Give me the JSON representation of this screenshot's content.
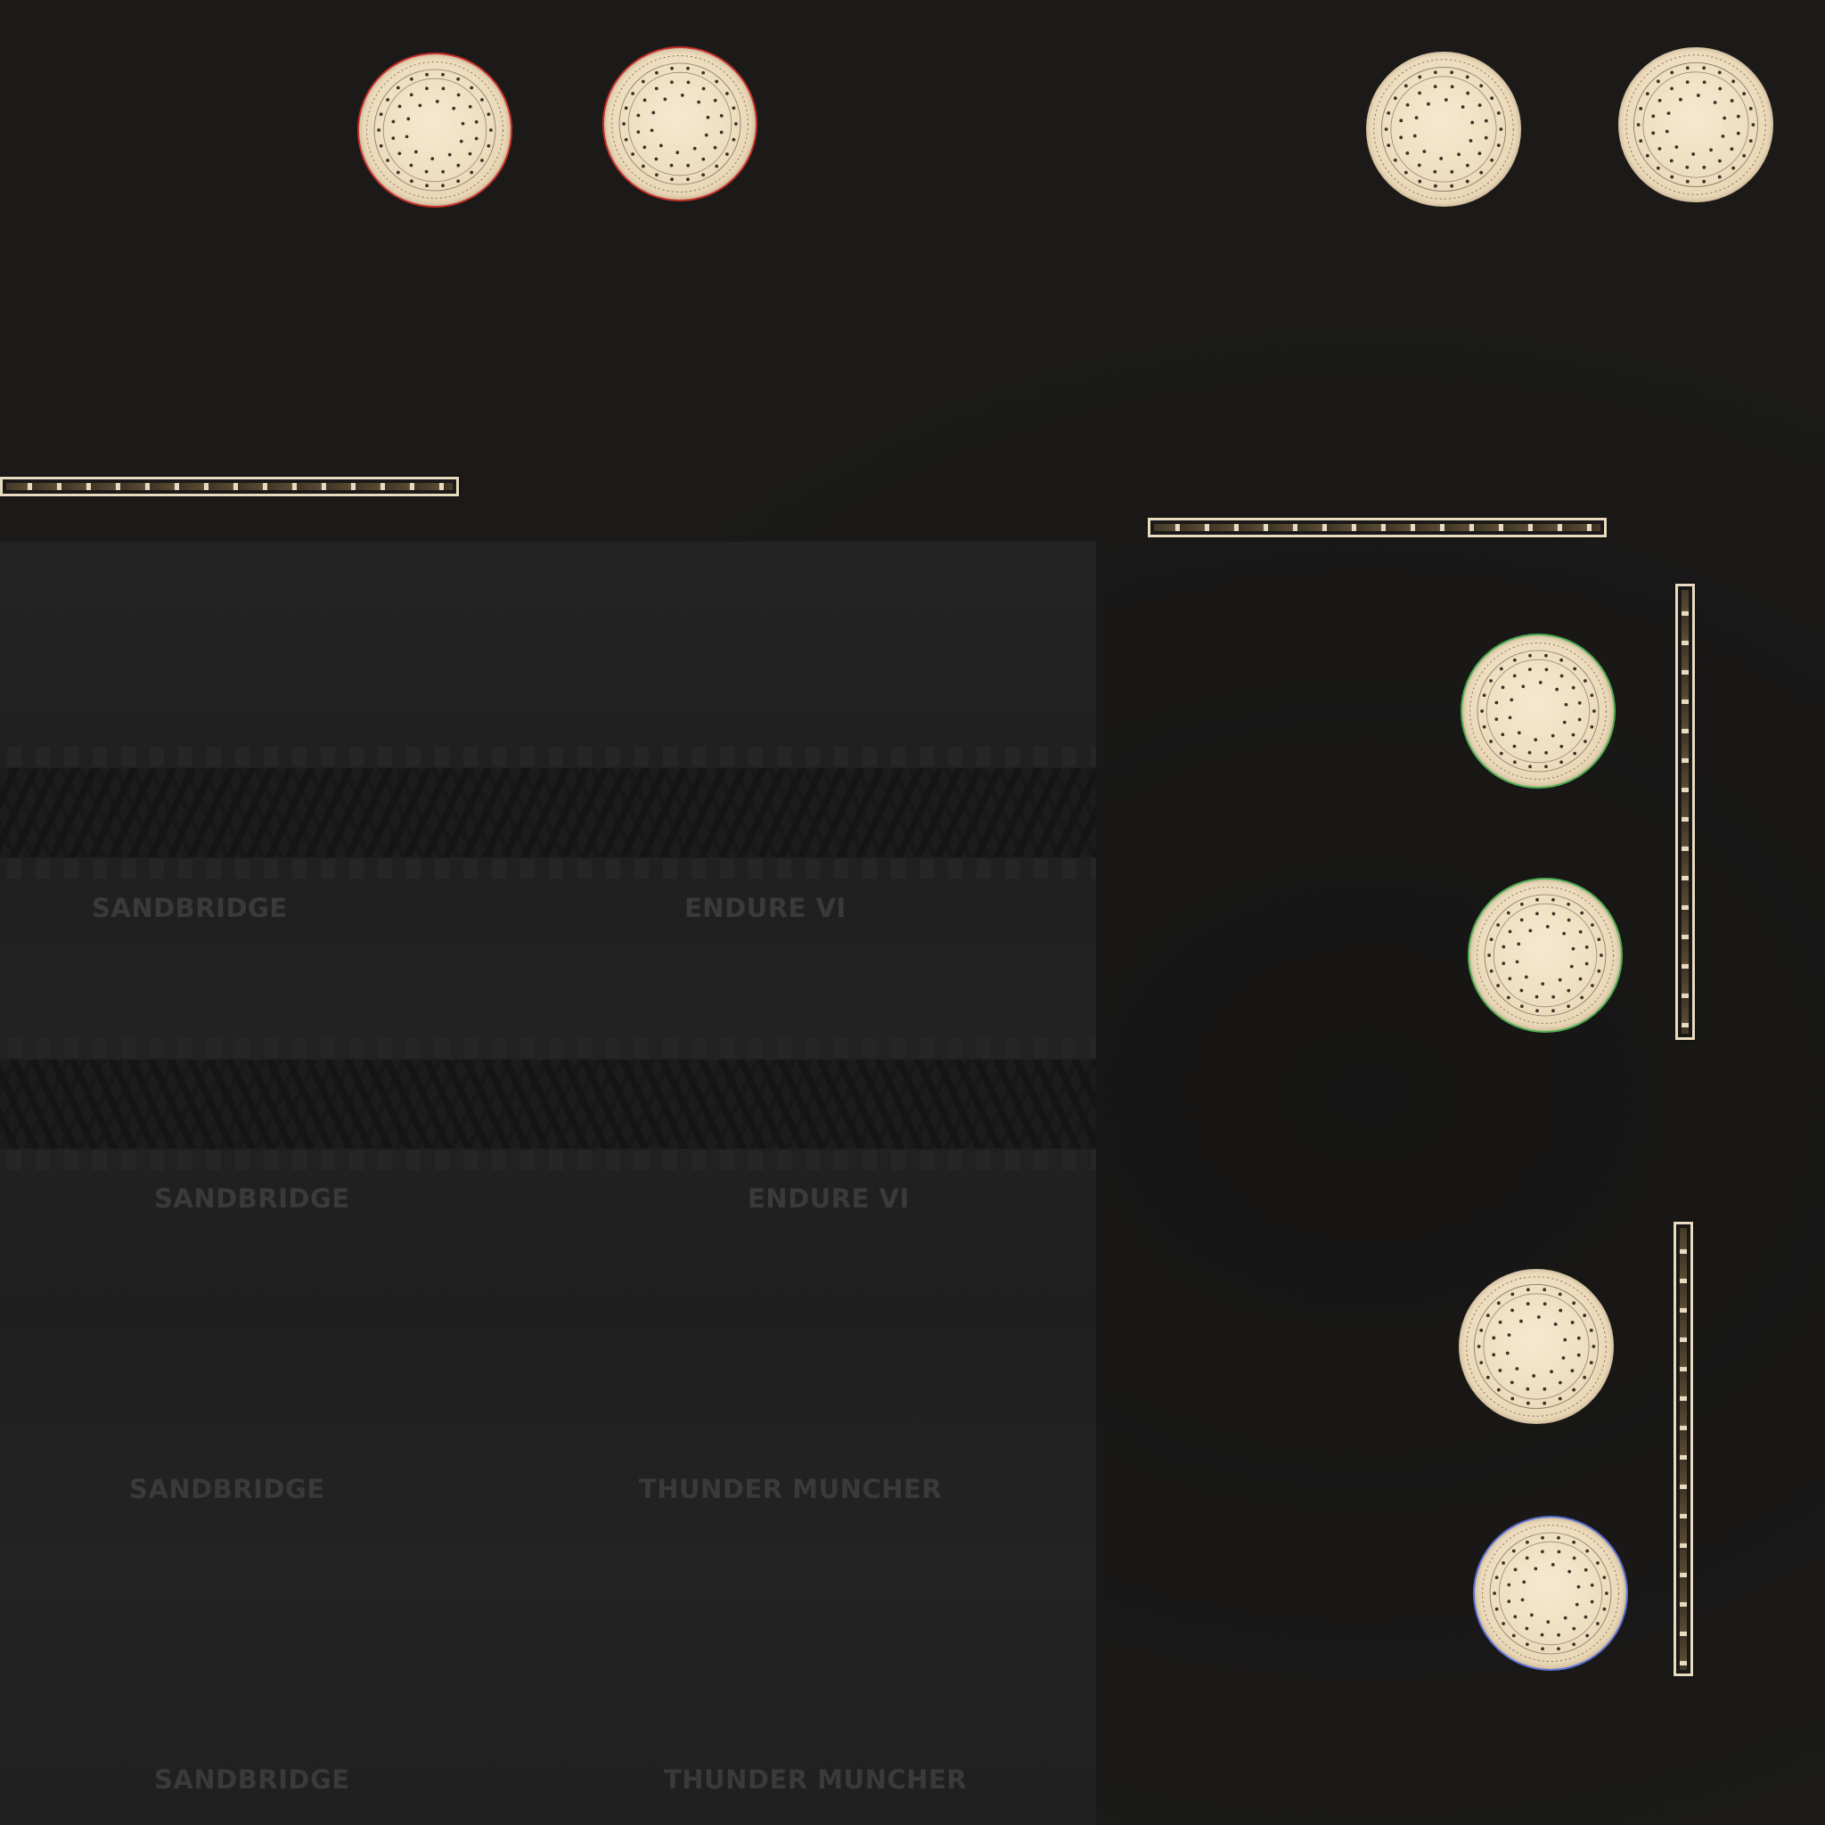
{
  "texture": {
    "tire_labels": [
      {
        "brand": "SANDBRIDGE",
        "model": "ENDURE VI"
      },
      {
        "brand": "SANDBRIDGE",
        "model": "ENDURE VI"
      },
      {
        "brand": "SANDBRIDGE",
        "model": "THUNDER MUNCHER"
      },
      {
        "brand": "SANDBRIDGE",
        "model": "THUNDER MUNCHER"
      }
    ],
    "disc_count": 8,
    "rail_count": 4,
    "colors": {
      "background": "#1b1a19",
      "panel": "#222222",
      "disc": "#efdfc2",
      "label": "#3a3a3a"
    },
    "icons": [
      "brake-disc-icon",
      "ladder-rail-icon",
      "tire-tread-icon"
    ]
  }
}
